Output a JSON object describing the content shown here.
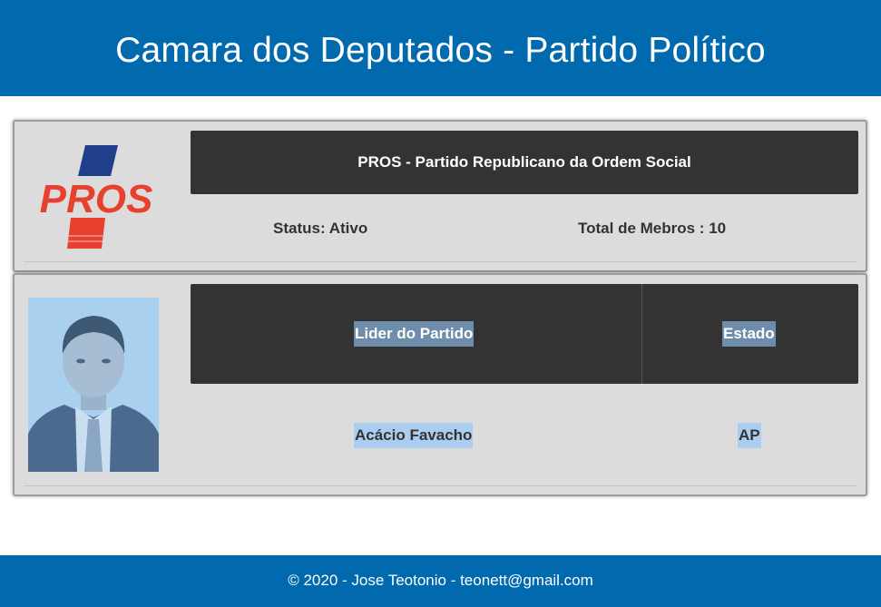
{
  "header": {
    "title": "Camara dos Deputados - Partido Político"
  },
  "party": {
    "logo_text": "PROS",
    "name": "PROS - Partido Republicano da Ordem Social",
    "status": "Status: Ativo",
    "members": "Total de Mebros : 10"
  },
  "leader_table": {
    "headers": [
      "Lider do Partido",
      "Estado"
    ],
    "row": [
      "Acácio Favacho",
      "AP"
    ]
  },
  "footer": {
    "text": "© 2020 - Jose Teotonio - teonett@gmail.com"
  },
  "colors": {
    "brand_blue": "#0169ad",
    "card_bg": "#dcdcdc",
    "dark_bar": "#333333",
    "logo_red": "#e8402e",
    "logo_navy": "#1f3f8a"
  }
}
